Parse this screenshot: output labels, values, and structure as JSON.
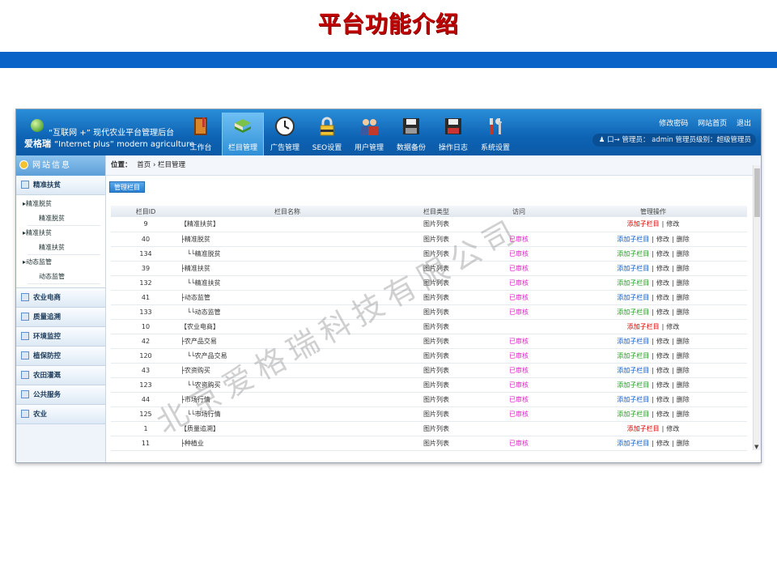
{
  "slide": {
    "title": "平台功能介绍",
    "band_color": "#0a64c8"
  },
  "watermark": "北京爱格瑞科技有限公司",
  "header": {
    "logo_line1": "“互联网 +” 现代农业平台管理后台",
    "logo_brand": "爱格瑞",
    "logo_line2_en": "“Internet plus” modern agriculture",
    "nav": [
      {
        "label": "工作台",
        "icon": "book-icon"
      },
      {
        "label": "栏目管理",
        "icon": "books-stack-icon",
        "active": true
      },
      {
        "label": "广告管理",
        "icon": "clock-icon"
      },
      {
        "label": "SEO设置",
        "icon": "lock-icon"
      },
      {
        "label": "用户管理",
        "icon": "users-icon"
      },
      {
        "label": "数据备份",
        "icon": "floppy-disk-icon"
      },
      {
        "label": "操作日志",
        "icon": "floppy-log-icon"
      },
      {
        "label": "系统设置",
        "icon": "tools-icon"
      }
    ],
    "links": [
      "修改密码",
      "网站首页",
      "退出"
    ],
    "user_bar": "口→ 管理员： admin 管理员级别：超级管理员"
  },
  "sidebar": {
    "title": "网站信息",
    "group_first": "精准扶贫",
    "sub": [
      {
        "cat": "精准脱贫",
        "leaf": "精准脱贫"
      },
      {
        "cat": "精准扶贫",
        "leaf": "精准扶贫"
      },
      {
        "cat": "动态监管",
        "leaf": "动态监管"
      }
    ],
    "groups": [
      "农业电商",
      "质量追溯",
      "环境监控",
      "植保防控",
      "农田灌溉",
      "公共服务",
      "农业"
    ]
  },
  "main": {
    "crumb_label": "位置：",
    "crumb_home": "首页",
    "crumb_sep": "›",
    "crumb_current": "栏目管理",
    "manage_button": "管理栏目",
    "columns": [
      "栏目ID",
      "栏目名称",
      "栏目类型",
      "访问",
      "管理操作"
    ],
    "op_labels": {
      "add_child": "添加子栏目",
      "add": "添加子栏目",
      "edit": "修改",
      "delete": "删除",
      "sep": "|"
    },
    "rows": [
      {
        "id": "9",
        "name": "【精准扶贫】",
        "type": "图片列表",
        "access": "",
        "ops": "top"
      },
      {
        "id": "40",
        "name": "├精准脱贫",
        "type": "图片列表",
        "access": "已审核",
        "ops": "blue"
      },
      {
        "id": "134",
        "name": "　└└精准脱贫",
        "type": "图片列表",
        "access": "已审核",
        "ops": "green"
      },
      {
        "id": "39",
        "name": "├精准扶贫",
        "type": "图片列表",
        "access": "已审核",
        "ops": "blue"
      },
      {
        "id": "132",
        "name": "　└└精准扶贫",
        "type": "图片列表",
        "access": "已审核",
        "ops": "green"
      },
      {
        "id": "41",
        "name": "├动态监管",
        "type": "图片列表",
        "access": "已审核",
        "ops": "blue"
      },
      {
        "id": "133",
        "name": "　└└动态监管",
        "type": "图片列表",
        "access": "已审核",
        "ops": "green"
      },
      {
        "id": "10",
        "name": "【农业电商】",
        "type": "图片列表",
        "access": "",
        "ops": "top"
      },
      {
        "id": "42",
        "name": "├农产品交易",
        "type": "图片列表",
        "access": "已审核",
        "ops": "blue"
      },
      {
        "id": "120",
        "name": "　└└农产品交易",
        "type": "图片列表",
        "access": "已审核",
        "ops": "green"
      },
      {
        "id": "43",
        "name": "├农资购买",
        "type": "图片列表",
        "access": "已审核",
        "ops": "blue"
      },
      {
        "id": "123",
        "name": "　└└农资购买",
        "type": "图片列表",
        "access": "已审核",
        "ops": "green"
      },
      {
        "id": "44",
        "name": "├市场行情",
        "type": "图片列表",
        "access": "已审核",
        "ops": "blue"
      },
      {
        "id": "125",
        "name": "　└└市场行情",
        "type": "图片列表",
        "access": "已审核",
        "ops": "green"
      },
      {
        "id": "1",
        "name": "【质量追溯】",
        "type": "图片列表",
        "access": "",
        "ops": "top"
      },
      {
        "id": "11",
        "name": "├种植业",
        "type": "图片列表",
        "access": "已审核",
        "ops": "blue"
      }
    ]
  }
}
